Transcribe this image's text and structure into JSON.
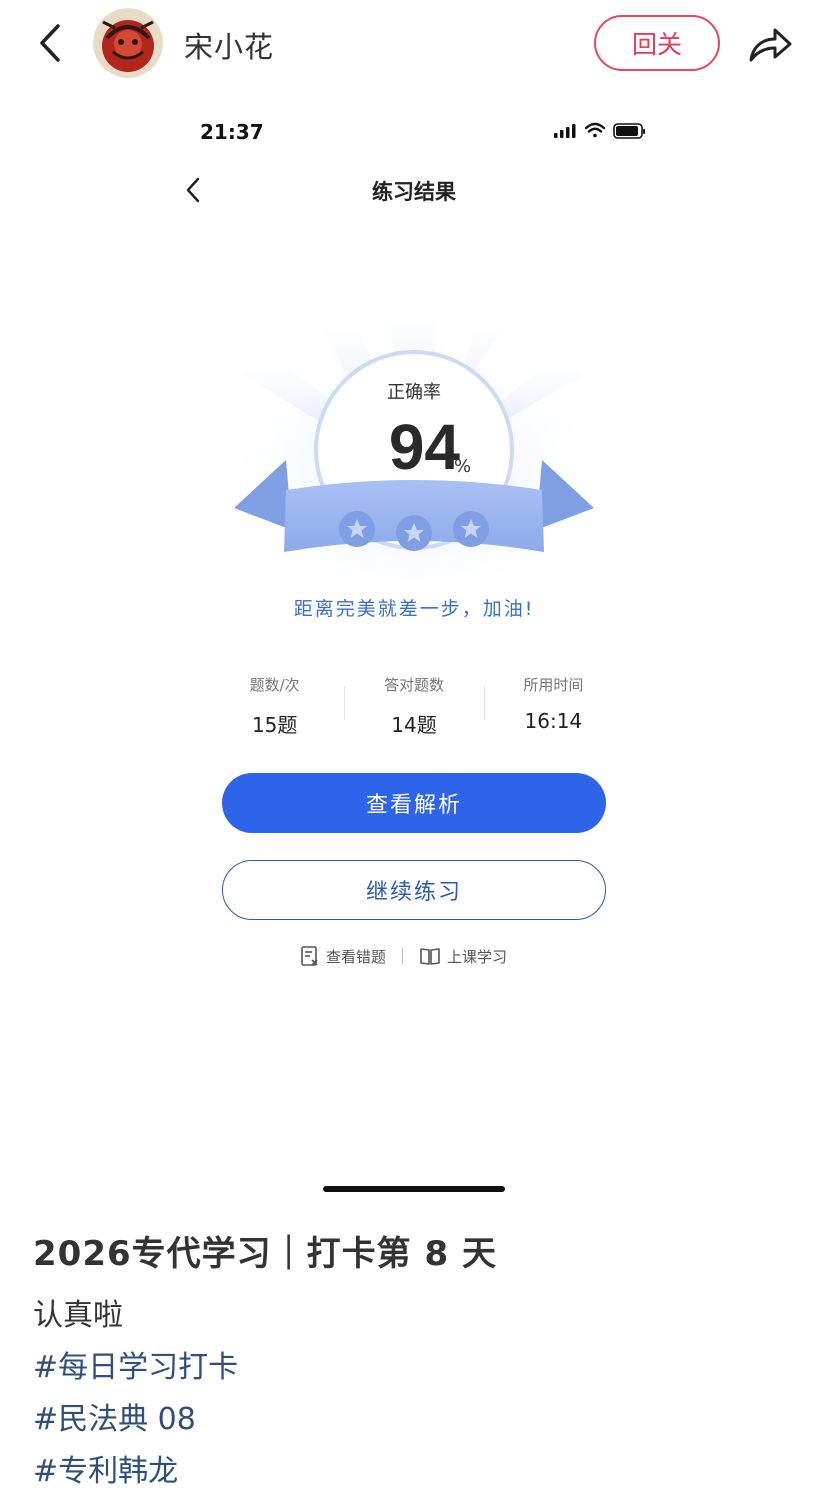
{
  "post_header": {
    "author_name": "宋小花",
    "follow_label": "回关"
  },
  "inner_screen": {
    "status_time": "21:37",
    "nav_title": "练习结果",
    "accuracy_label": "正确率",
    "accuracy_value": "94",
    "accuracy_unit": "%",
    "stars": 3,
    "encourage_text": "距离完美就差一步，加油!",
    "stats": [
      {
        "label": "题数/次",
        "value": "15题"
      },
      {
        "label": "答对题数",
        "value": "14题"
      },
      {
        "label": "所用时间",
        "value": "16:14"
      }
    ],
    "primary_button": "查看解析",
    "secondary_button": "继续练习",
    "links": {
      "wrong_questions": "查看错题",
      "attend_class": "上课学习"
    }
  },
  "post": {
    "title": "2026专代学习｜打卡第 8 天",
    "text": "认真啦",
    "tags": [
      "#每日学习打卡",
      "#民法典 08",
      "#专利韩龙"
    ]
  },
  "colors": {
    "accent_red": "#e33c58",
    "primary_blue": "#2e64ea",
    "tag_blue": "#2f4f7a"
  }
}
